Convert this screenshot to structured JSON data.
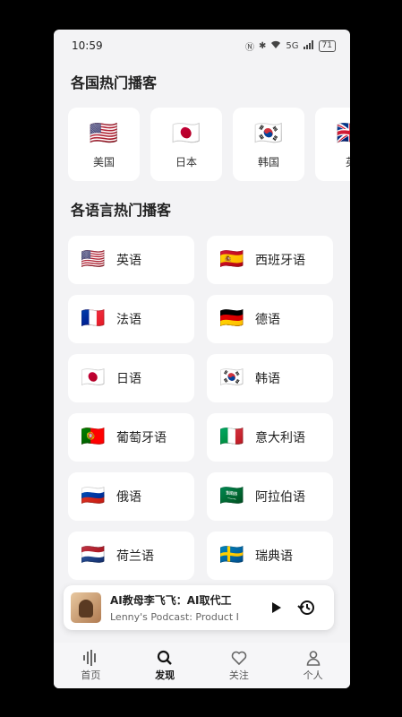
{
  "status_bar": {
    "time": "10:59",
    "battery": "71",
    "signal_label": "5G"
  },
  "countries_section": {
    "title": "各国热门播客",
    "items": [
      {
        "label": "美国",
        "flag": "🇺🇸"
      },
      {
        "label": "日本",
        "flag": "🇯🇵"
      },
      {
        "label": "韩国",
        "flag": "🇰🇷"
      },
      {
        "label": "英",
        "flag": "🇬🇧"
      }
    ]
  },
  "languages_section": {
    "title": "各语言热门播客",
    "items": [
      {
        "label": "英语",
        "flag": "🇺🇸"
      },
      {
        "label": "西班牙语",
        "flag": "🇪🇸"
      },
      {
        "label": "法语",
        "flag": "🇫🇷"
      },
      {
        "label": "德语",
        "flag": "🇩🇪"
      },
      {
        "label": "日语",
        "flag": "🇯🇵"
      },
      {
        "label": "韩语",
        "flag": "🇰🇷"
      },
      {
        "label": "葡萄牙语",
        "flag": "🇵🇹"
      },
      {
        "label": "意大利语",
        "flag": "🇮🇹"
      },
      {
        "label": "俄语",
        "flag": "🇷🇺"
      },
      {
        "label": "阿拉伯语",
        "flag": "🇸🇦"
      },
      {
        "label": "荷兰语",
        "flag": "🇳🇱"
      },
      {
        "label": "瑞典语",
        "flag": "🇸🇪"
      }
    ]
  },
  "now_playing": {
    "title": "AI教母李飞飞：AI取代工",
    "subtitle": "Lenny's Podcast: Product I"
  },
  "tab_bar": {
    "items": [
      {
        "label": "首页",
        "icon": "waveform-icon"
      },
      {
        "label": "发现",
        "icon": "search-icon"
      },
      {
        "label": "关注",
        "icon": "heart-icon"
      },
      {
        "label": "个人",
        "icon": "person-icon"
      }
    ],
    "active_index": 1
  }
}
